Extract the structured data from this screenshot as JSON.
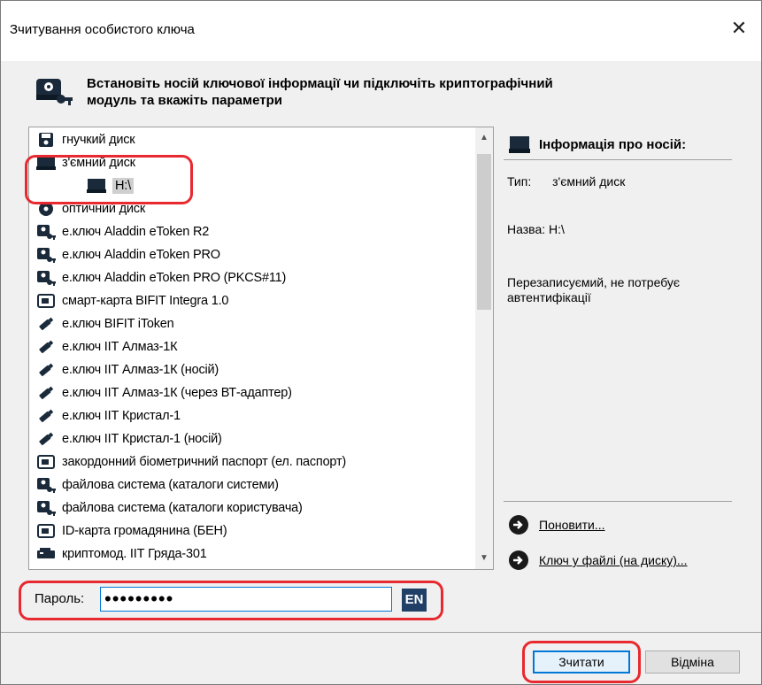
{
  "window": {
    "title": "Зчитування особистого ключа",
    "close_glyph": "✕"
  },
  "header": {
    "text_line1": "Встановіть носій ключової інформації чи підключіть криптографічний",
    "text_line2": "модуль та вкажіть параметри",
    "icon": "key-media-icon"
  },
  "devices": [
    {
      "label": "гнучкий диск",
      "icon": "floppy-icon"
    },
    {
      "label": "з'ємний диск",
      "icon": "removable-drive-icon"
    },
    {
      "label": "H:\\",
      "icon": "drive-icon",
      "selected": true
    },
    {
      "label": "оптичний диск",
      "icon": "optical-disc-icon"
    },
    {
      "label": "е.ключ Aladdin eToken R2",
      "icon": "key-media-icon"
    },
    {
      "label": "е.ключ Aladdin eToken PRO",
      "icon": "key-media-icon"
    },
    {
      "label": "е.ключ Aladdin eToken PRO (PKCS#11)",
      "icon": "key-media-icon"
    },
    {
      "label": "смарт-карта BIFIT Integra 1.0",
      "icon": "smartcard-icon"
    },
    {
      "label": "е.ключ BIFIT iToken",
      "icon": "usb-token-icon"
    },
    {
      "label": "е.ключ ІІТ Алмаз-1К",
      "icon": "usb-token-icon"
    },
    {
      "label": "е.ключ ІІТ Алмаз-1К (носій)",
      "icon": "usb-token-icon"
    },
    {
      "label": "е.ключ ІІТ Алмаз-1К (через ВТ-адаптер)",
      "icon": "usb-token-icon"
    },
    {
      "label": "е.ключ ІІТ Кристал-1",
      "icon": "usb-token-icon"
    },
    {
      "label": "е.ключ ІІТ Кристал-1 (носій)",
      "icon": "usb-token-icon"
    },
    {
      "label": "закордонний біометричний паспорт (ел. паспорт)",
      "icon": "smartcard-icon"
    },
    {
      "label": "файлова система (каталоги системи)",
      "icon": "key-media-icon"
    },
    {
      "label": "файлова система (каталоги користувача)",
      "icon": "key-media-icon"
    },
    {
      "label": "ID-карта громадянина (БЕН)",
      "icon": "smartcard-icon"
    },
    {
      "label": "криптомод. ІІТ Гряда-301",
      "icon": "crypto-module-icon"
    }
  ],
  "info": {
    "title": "Інформація про носій:",
    "type_label": "Тип:",
    "type_value": "з'ємний диск",
    "name_label": "Назва:",
    "name_value": "H:\\",
    "desc_line1": "Перезаписуємий, не потребує",
    "desc_line2": "автентифікації"
  },
  "links": {
    "refresh": "Поновити...",
    "file_key": "Ключ у файлі (на диску)..."
  },
  "password": {
    "label": "Пароль:",
    "value": "•••••••••",
    "lang": "EN"
  },
  "buttons": {
    "read": "Зчитати",
    "cancel": "Відміна"
  },
  "colors": {
    "highlight": "#e8292f",
    "accent": "#0078d7",
    "lang_bg": "#1f3f66"
  }
}
